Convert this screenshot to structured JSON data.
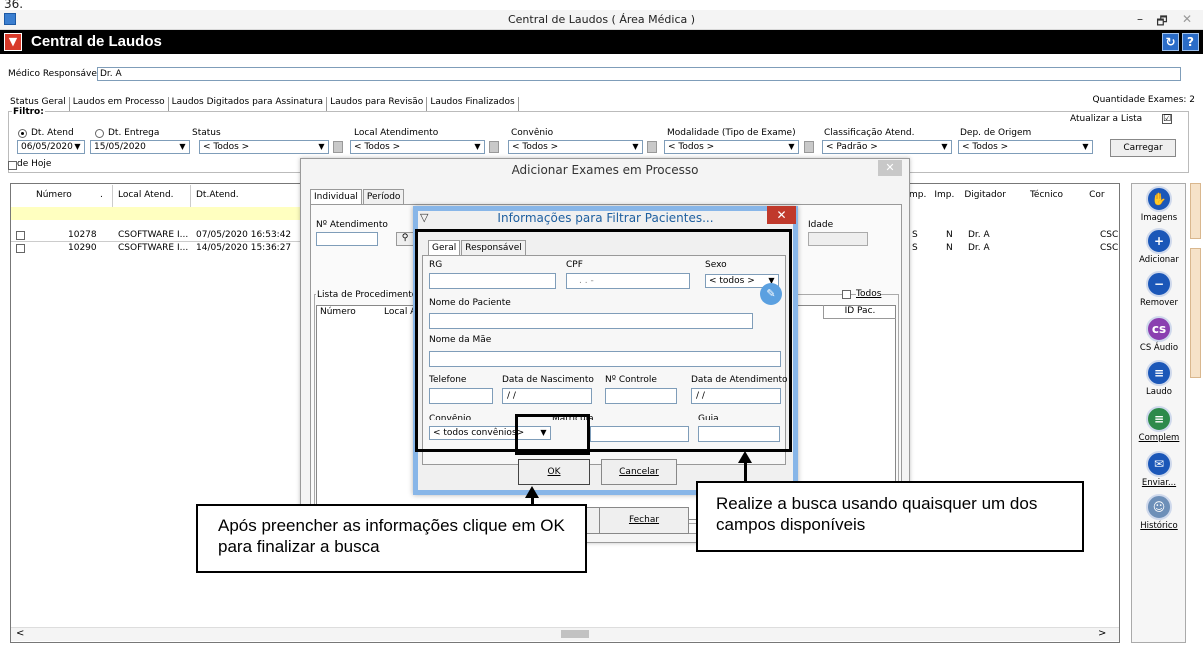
{
  "stray_text": "36.",
  "window": {
    "title": "Central de Laudos ( Área Médica )",
    "minimize": "–",
    "maximize": "🗗",
    "close": "✕"
  },
  "header": {
    "title": "Central de Laudos",
    "btn1": "↻",
    "btn2": "?"
  },
  "medico": {
    "label": "Médico Responsável:",
    "value": "Dr. A"
  },
  "tabs": [
    "Status Geral",
    "Laudos em Processo",
    "Laudos Digitados para Assinatura",
    "Laudos para Revisão",
    "Laudos Finalizados"
  ],
  "quantidade": "Quantidade Exames: 2",
  "filtro": {
    "label": "Filtro:",
    "atualizar": "Atualizar a Lista",
    "atualizar_checked": "☑",
    "dt_atend": "Dt. Atend",
    "dt_entrega": "Dt. Entrega",
    "status_label": "Status",
    "local_label": "Local Atendimento",
    "convenio_label": "Convênio",
    "modalidade_label": "Modalidade (Tipo de Exame)",
    "classif_label": "Classificação Atend.",
    "dep_label": "Dep. de Origem",
    "date1": "06/05/2020",
    "date2": "15/05/2020",
    "status_value": "< Todos >",
    "local_value": "< Todos >",
    "convenio_value": "< Todos >",
    "modalidade_value": "< Todos >",
    "classif_value": "< Padrão >",
    "dep_value": "< Todos >",
    "carregar": "Carregar",
    "de_hoje": "de Hoje"
  },
  "grid": {
    "headers": [
      "Número",
      ".",
      "Local Atend.",
      "Dt.Atend."
    ],
    "right_headers": [
      "mp.",
      "Imp.",
      "Digitador",
      "Técnico",
      "Cor"
    ],
    "rows": [
      {
        "numero": "10278",
        "local": "CSOFTWARE I...",
        "dt": "07/05/2020 16:53:42",
        "mp": "S",
        "imp": "N",
        "dig": "Dr. A",
        "cor": "CSC"
      },
      {
        "numero": "10290",
        "local": "CSOFTWARE I...",
        "dt": "14/05/2020 15:36:27",
        "mp": "S",
        "imp": "N",
        "dig": "Dr. A",
        "cor": "CSC"
      }
    ],
    "scroll_left": "<",
    "scroll_right": ">"
  },
  "right_panel": [
    "Imagens",
    "Adicionar",
    "Remover",
    "CS Áudio",
    "Laudo",
    "Complem",
    "Enviar...",
    "Histórico"
  ],
  "dialog_add": {
    "title": "Adicionar Exames em Processo",
    "close": "✕",
    "tab_individual": "Individual",
    "tab_periodo": "Período",
    "natendimento_label": "Nº Atendimento",
    "idade_label": "Idade",
    "lista_label": "Lista de Procedimentos",
    "lista_col1": "Número",
    "lista_col2": "Local A",
    "todos": "Todos",
    "idpac": "ID Pac.",
    "fechar": "Fechar"
  },
  "dialog_filter": {
    "title": "Informações para Filtrar Pacientes...",
    "close": "✕",
    "tab_geral": "Geral",
    "tab_resp": "Responsável",
    "rg": "RG",
    "cpf": "CPF",
    "cpf_value": ". . -",
    "sexo": "Sexo",
    "sexo_value": "< todos >",
    "nome_paciente": "Nome do Paciente",
    "nome_mae": "Nome da Mãe",
    "telefone": "Telefone",
    "data_nasc": "Data de Nascimento",
    "data_nasc_value": "/ /",
    "n_controle": "Nº Controle",
    "data_atend": "Data de Atendimento",
    "data_atend_value": "/ /",
    "convenio": "Convênio",
    "convenio_value": "< todos convênios>",
    "matricula": "Matrícula",
    "guia": "Guia",
    "ok": "OK",
    "cancelar": "Cancelar"
  },
  "annotations": {
    "left": "Após preencher as informações clique em OK para finalizar a busca",
    "right": "Realize a busca usando quaisquer um dos campos disponíveis"
  }
}
